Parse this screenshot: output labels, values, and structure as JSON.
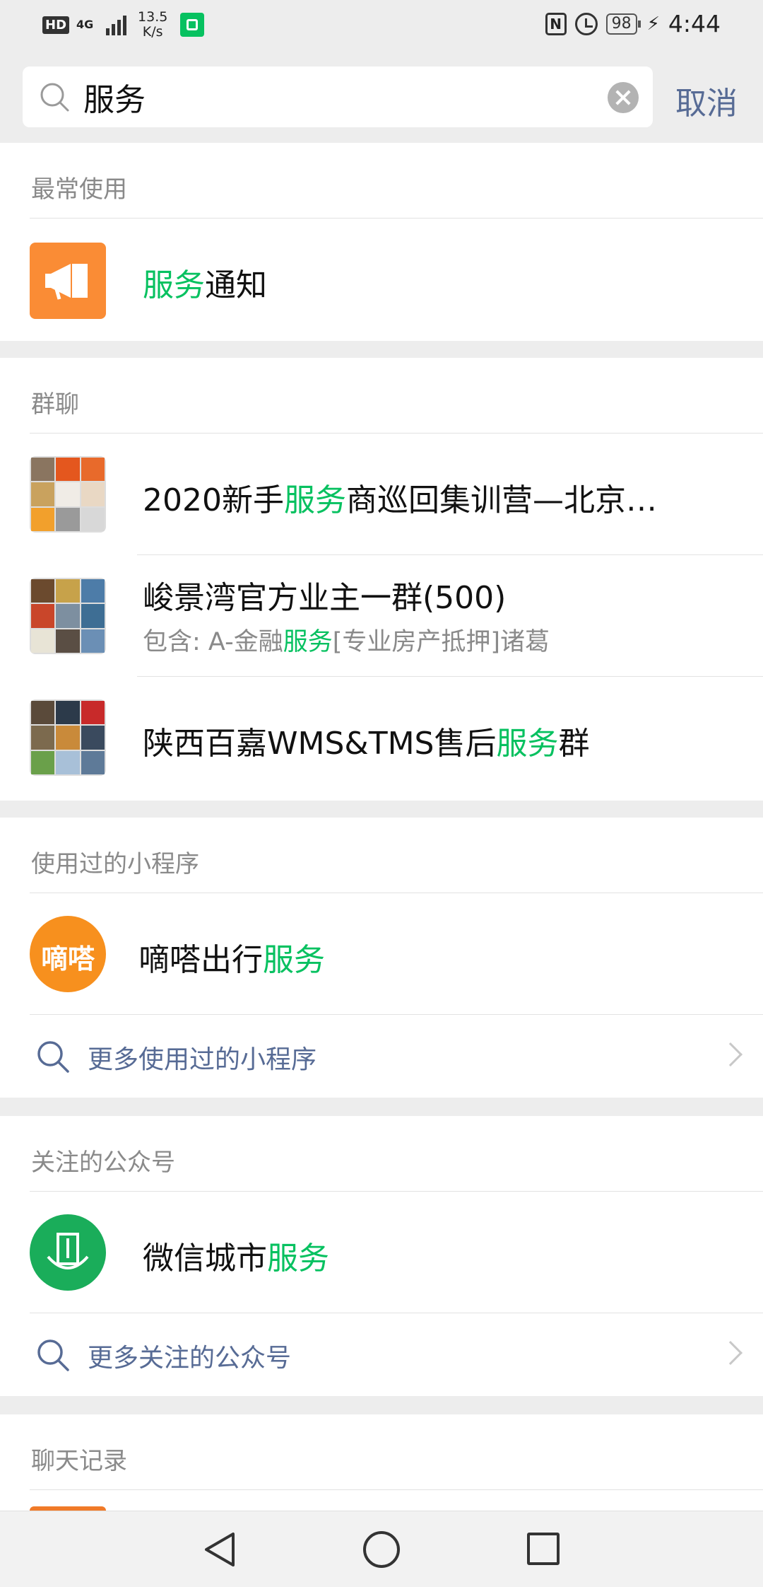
{
  "status_bar": {
    "hd": "HD",
    "network": "4G",
    "speed_value": "13.5",
    "speed_unit": "K/s",
    "nfc": "N",
    "battery": "98",
    "time": "4:44"
  },
  "search": {
    "query": "服务",
    "cancel_label": "取消"
  },
  "sections": {
    "frequent": {
      "title": "最常使用",
      "items": [
        {
          "highlight": "服务",
          "rest": "通知"
        }
      ]
    },
    "groups": {
      "title": "群聊",
      "items": [
        {
          "prefix": "2020新手",
          "highlight": "服务",
          "rest": "商巡回集训营—北京…"
        },
        {
          "name": "峻景湾官方业主一群(500)",
          "sub_prefix": "包含: A-金融",
          "sub_highlight": "服务",
          "sub_rest": "[专业房产抵押]诸葛"
        },
        {
          "prefix": "陕西百嘉WMS&TMS售后",
          "highlight": "服务",
          "rest": "群"
        }
      ]
    },
    "mini_programs": {
      "title": "使用过的小程序",
      "items": [
        {
          "logo_text": "嘀嗒",
          "prefix": "嘀嗒出行",
          "highlight": "服务"
        }
      ],
      "more_label": "更多使用过的小程序"
    },
    "official_accounts": {
      "title": "关注的公众号",
      "items": [
        {
          "prefix": "微信城市",
          "highlight": "服务"
        }
      ],
      "more_label": "更多关注的公众号"
    },
    "chat_history": {
      "title": "聊天记录"
    }
  },
  "colors": {
    "highlight": "#07c160",
    "link": "#576b95",
    "notice_orange": "#fa8c35"
  }
}
